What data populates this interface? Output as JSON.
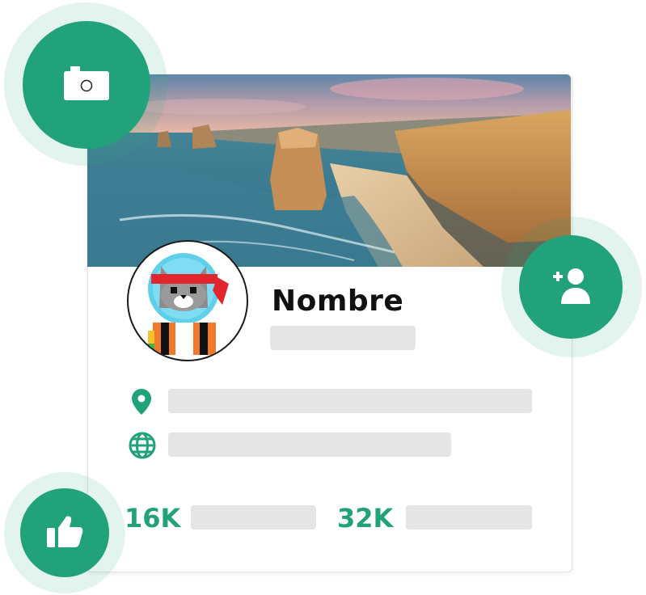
{
  "profile": {
    "name": "Nombre"
  },
  "stats": {
    "first": "16K",
    "second": "32K"
  },
  "icons": {
    "camera": "camera-icon",
    "add_user": "add-user-icon",
    "like": "thumbs-up-icon",
    "location": "location-pin-icon",
    "website": "globe-icon"
  },
  "colors": {
    "accent": "#21a27b",
    "halo": "#e5f4ec",
    "placeholder": "#e5e5e5",
    "text": "#111111"
  }
}
